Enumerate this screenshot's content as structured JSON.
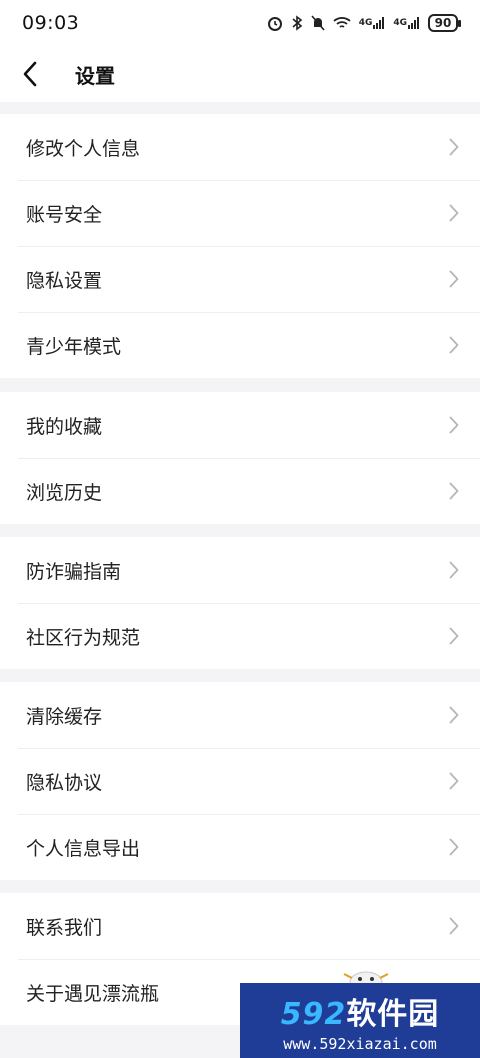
{
  "status": {
    "time": "09:03",
    "net1": "4G",
    "net2": "4G",
    "battery": "90"
  },
  "header": {
    "title": "设置"
  },
  "groups": [
    {
      "items": [
        "修改个人信息",
        "账号安全",
        "隐私设置",
        "青少年模式"
      ]
    },
    {
      "items": [
        "我的收藏",
        "浏览历史"
      ]
    },
    {
      "items": [
        "防诈骗指南",
        "社区行为规范"
      ]
    },
    {
      "items": [
        "清除缓存",
        "隐私协议",
        "个人信息导出"
      ]
    },
    {
      "items": [
        "联系我们",
        "关于遇见漂流瓶"
      ]
    }
  ],
  "watermark": {
    "num": "592",
    "text": "软件园",
    "url": "www.592xiazai.com"
  },
  "colors": {
    "background": "#f4f4f6",
    "row_background": "#ffffff",
    "chevron": "#b5b5bb",
    "watermark_bg": "#1f3c96",
    "watermark_accent": "#39b7ff"
  }
}
